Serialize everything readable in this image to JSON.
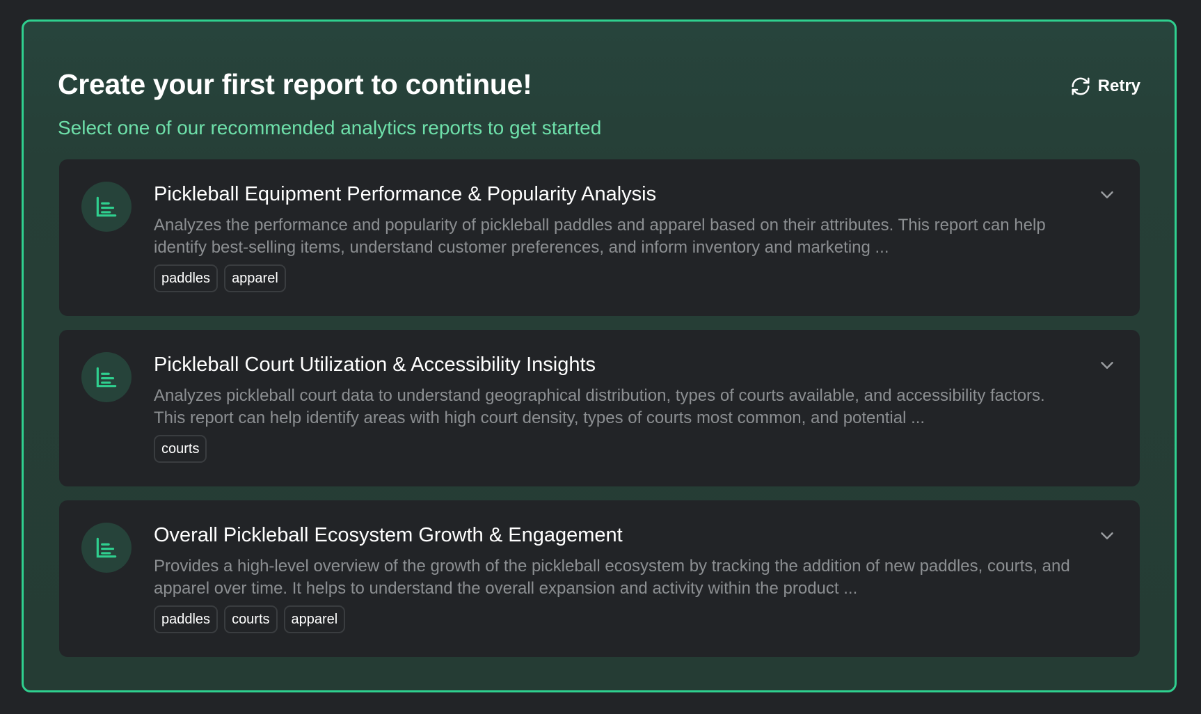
{
  "header": {
    "title": "Create your first report to continue!",
    "subtitle": "Select one of our recommended analytics reports to get started",
    "retry_label": "Retry",
    "retry_icon": "refresh-icon"
  },
  "colors": {
    "accent": "#2fd08f",
    "subtitle": "#6ee0aa",
    "card_bg": "#222427",
    "panel_bg": "#26433a"
  },
  "reports": [
    {
      "title": "Pickleball Equipment Performance & Popularity Analysis",
      "description": "Analyzes the performance and popularity of pickleball paddles and apparel based on their attributes. This report can help identify best-selling items, understand customer preferences, and inform inventory and marketing ...",
      "tags": [
        "paddles",
        "apparel"
      ],
      "icon": "bar-chart-icon"
    },
    {
      "title": "Pickleball Court Utilization & Accessibility Insights",
      "description": "Analyzes pickleball court data to understand geographical distribution, types of courts available, and accessibility factors. This report can help identify areas with high court density, types of courts most common, and potential ...",
      "tags": [
        "courts"
      ],
      "icon": "bar-chart-icon"
    },
    {
      "title": "Overall Pickleball Ecosystem Growth & Engagement",
      "description": "Provides a high-level overview of the growth of the pickleball ecosystem by tracking the addition of new paddles, courts, and apparel over time. It helps to understand the overall expansion and activity within the product ...",
      "tags": [
        "paddles",
        "courts",
        "apparel"
      ],
      "icon": "bar-chart-icon"
    }
  ]
}
